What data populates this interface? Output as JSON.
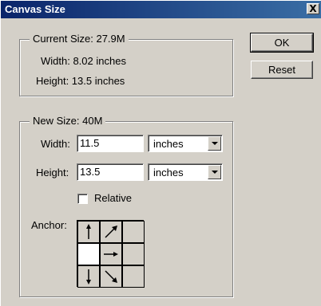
{
  "window": {
    "title": "Canvas Size",
    "close_label": "X"
  },
  "current_size": {
    "group_title": "Current Size: 27.9M",
    "width_text": "Width: 8.02 inches",
    "height_text": "Height: 13.5 inches"
  },
  "buttons": {
    "ok_label": "OK",
    "reset_label": "Reset"
  },
  "new_size": {
    "group_title": "New Size: 40M",
    "width_label": "Width:",
    "width_value": "11.5",
    "width_unit": "inches",
    "height_label": "Height:",
    "height_value": "13.5",
    "height_unit": "inches",
    "relative_label": "Relative",
    "relative_checked": false,
    "anchor_label": "Anchor:",
    "anchor_selected": "middle-left",
    "anchor_cells": [
      {
        "id": "top-left",
        "icon": "arrow-up-icon"
      },
      {
        "id": "top-center",
        "icon": "arrow-up-right-icon"
      },
      {
        "id": "top-right",
        "icon": "none"
      },
      {
        "id": "middle-left",
        "icon": "none"
      },
      {
        "id": "middle-center",
        "icon": "arrow-right-icon"
      },
      {
        "id": "middle-right",
        "icon": "none"
      },
      {
        "id": "bottom-left",
        "icon": "arrow-down-icon"
      },
      {
        "id": "bottom-center",
        "icon": "arrow-down-right-icon"
      },
      {
        "id": "bottom-right",
        "icon": "none"
      }
    ]
  },
  "colors": {
    "dialog_bg": "#d4d0c8",
    "titlebar_start": "#0a246a",
    "titlebar_end": "#3a6ea5",
    "outer_bg": "#f4c2dc"
  }
}
